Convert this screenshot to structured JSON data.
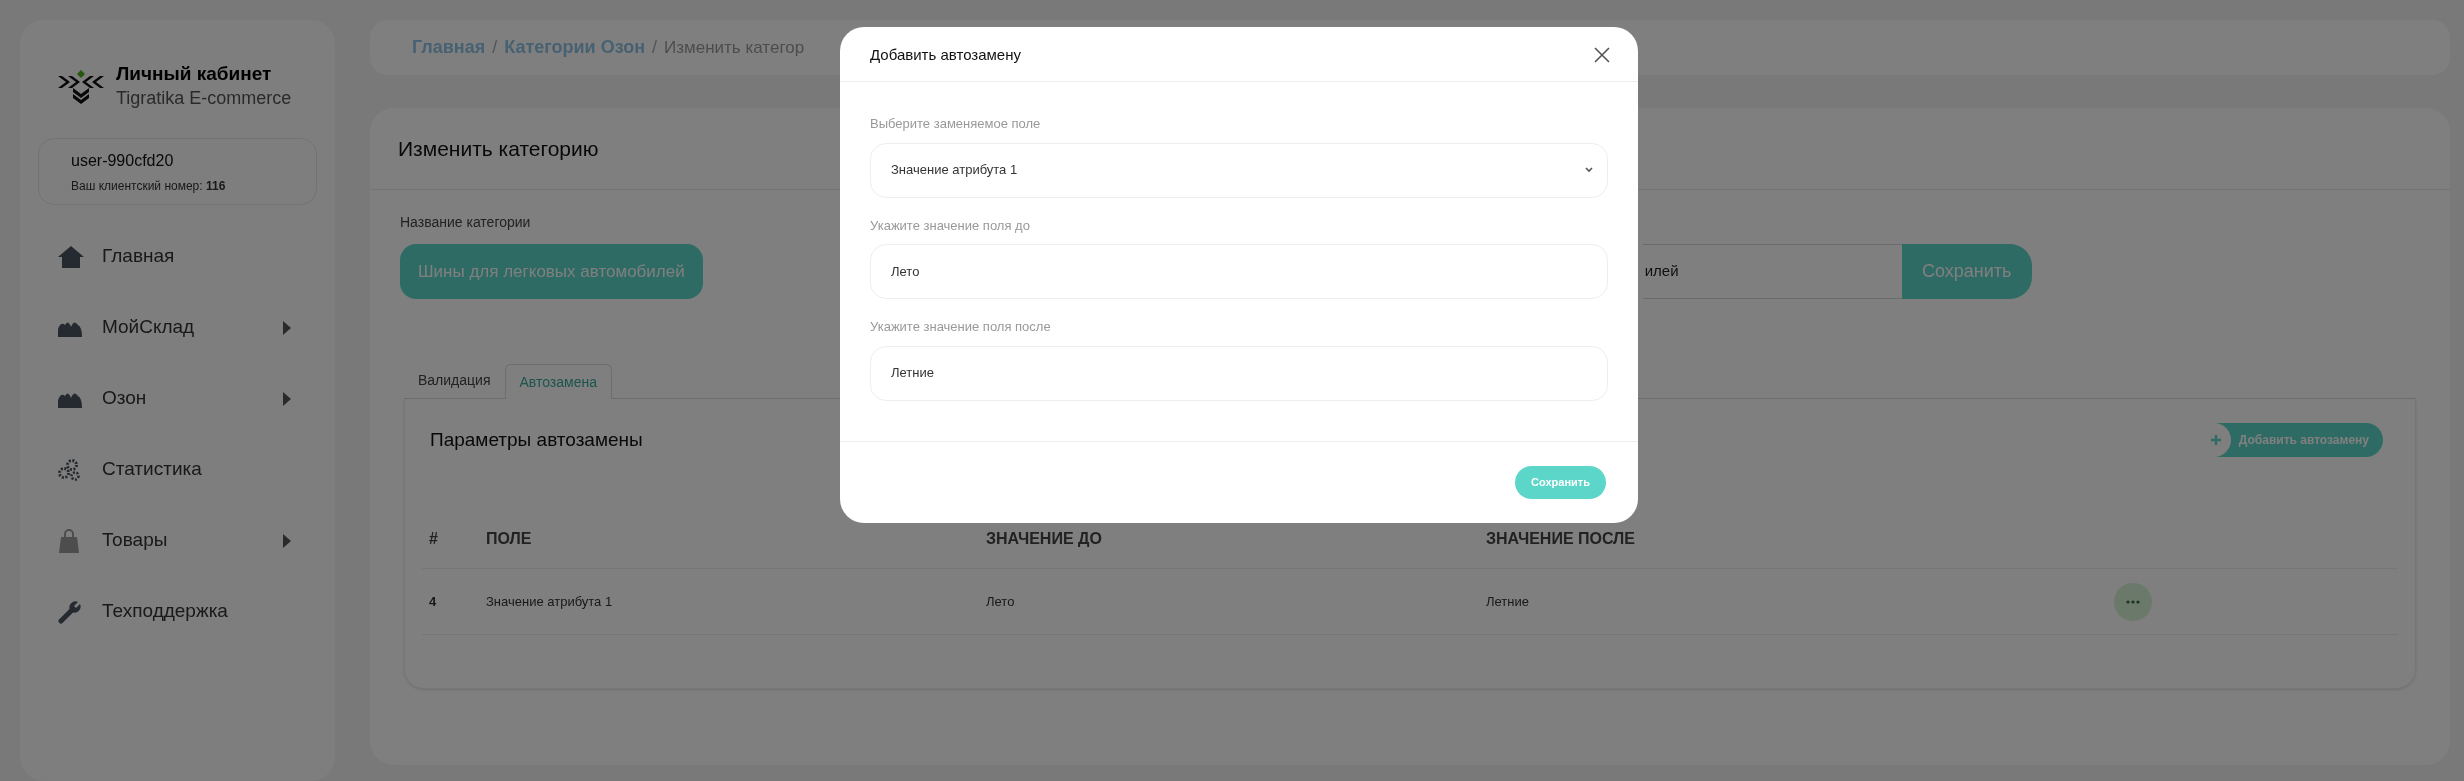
{
  "sidebar": {
    "title": "Личный кабинет",
    "subtitle": "Tigratika E-commerce",
    "user": {
      "name": "user-990cfd20",
      "client_number": "Ваш клиентский номер: **116**"
    },
    "nav": [
      {
        "label": "Главная",
        "has_submenu": false
      },
      {
        "label": "МойСклад",
        "has_submenu": true
      },
      {
        "label": "Озон",
        "has_submenu": true
      },
      {
        "label": "Статистика",
        "has_submenu": false
      },
      {
        "label": "Товары",
        "has_submenu": true
      },
      {
        "label": "Техподдержка",
        "has_submenu": false
      }
    ]
  },
  "breadcrumb": [
    {
      "kind": "link",
      "label": "Главная"
    },
    {
      "kind": "separator",
      "label": "/"
    },
    {
      "kind": "link",
      "label": "Категории Озон"
    },
    {
      "kind": "separator",
      "label": "/"
    },
    {
      "kind": "current",
      "label": "Изменить категор"
    }
  ],
  "edit_card": {
    "title": "Изменить категорию",
    "name_label": "Название категории",
    "category_button": "Шины для легковых автомобилей",
    "name_value": "илей",
    "save_button": "Сохранить",
    "tabs": [
      {
        "label": "Валидация",
        "selected": false
      },
      {
        "label": "Автозамена",
        "selected": true
      }
    ],
    "section_title": "Параметры автозамены",
    "add_button": "Добавить автозамену",
    "table": {
      "columns": [
        "#",
        "ПОЛЕ",
        "ЗНАЧЕНИЕ ДО",
        "ЗНАЧЕНИЕ ПОСЛЕ"
      ],
      "rows": [
        {
          "cells": [
            "4",
            "Значение атрибута 1",
            "Лето",
            "Летние"
          ]
        }
      ]
    }
  },
  "modal": {
    "title": "Добавить автозамену",
    "fields": [
      {
        "kind": "select",
        "label": "Выберите заменяемое поле",
        "value": "Значение атрибута 1"
      },
      {
        "kind": "input",
        "label": "Укажите значение поля до",
        "value": "Лето"
      },
      {
        "kind": "input",
        "label": "Укажите значение поля после",
        "value": "Летние"
      }
    ],
    "save_button": "Сохранить"
  }
}
